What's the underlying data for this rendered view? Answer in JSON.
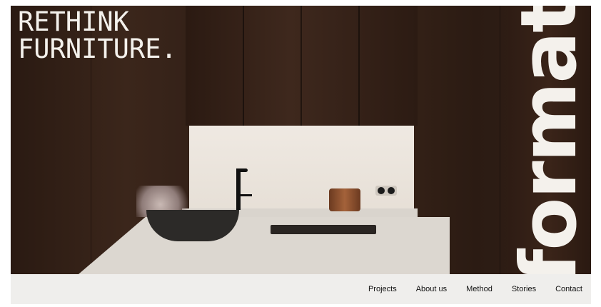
{
  "hero": {
    "headline_line1": "RETHINK",
    "headline_line2": "FURNITURE.",
    "brand": "format"
  },
  "nav": {
    "items": [
      {
        "label": "Projects"
      },
      {
        "label": "About us"
      },
      {
        "label": "Method"
      },
      {
        "label": "Stories"
      },
      {
        "label": "Contact"
      }
    ]
  },
  "colors": {
    "text_light": "#f4f1ec",
    "wood_dark": "#2f1e16",
    "nav_background": "#efeeec",
    "nav_text": "#111111"
  }
}
